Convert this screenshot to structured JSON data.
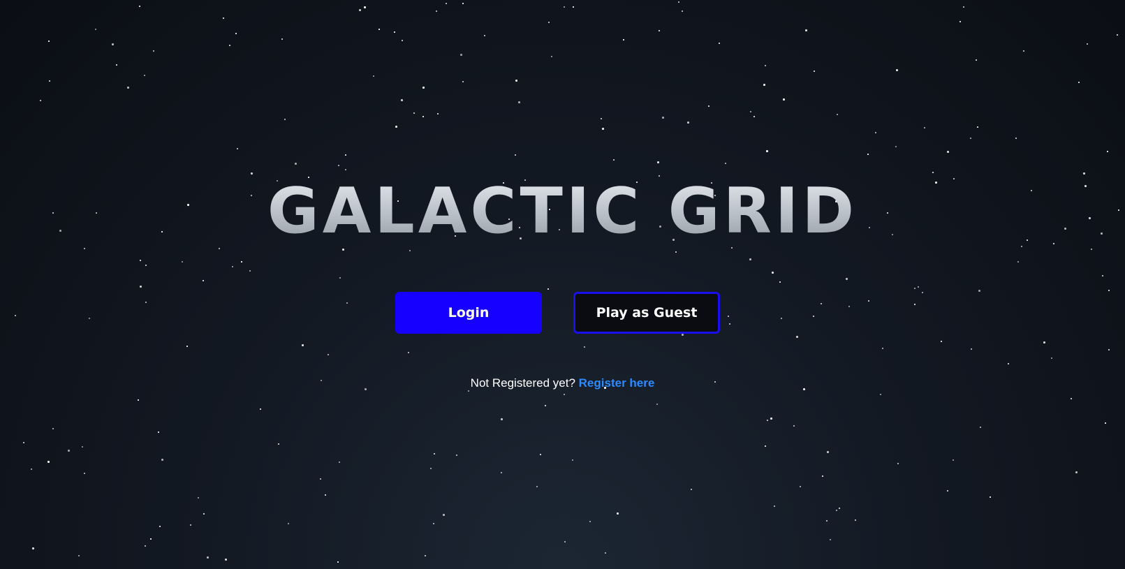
{
  "title": "GALACTIC GRID",
  "buttons": {
    "login_label": "Login",
    "guest_label": "Play as Guest"
  },
  "register": {
    "prompt": "Not Registered yet?",
    "link_label": "Register here"
  },
  "colors": {
    "login_button": "#1600ff",
    "guest_border": "#1a10ee",
    "link": "#2b8bff",
    "background": "#0b0e14"
  }
}
